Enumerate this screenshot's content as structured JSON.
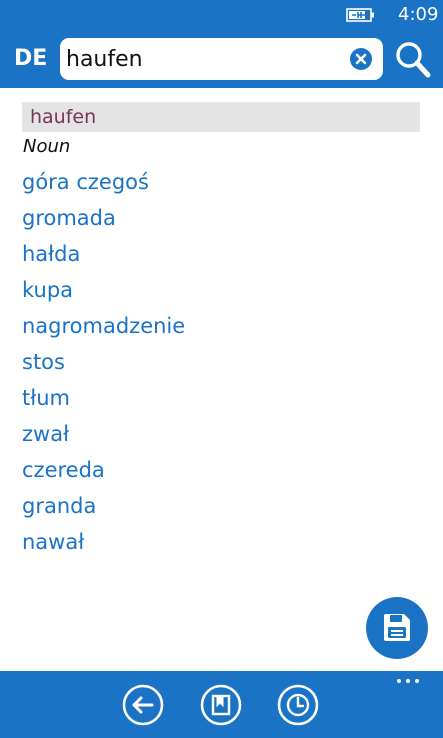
{
  "status_bar": {
    "time": "4:09",
    "battery_icon": "battery-charging-icon"
  },
  "header": {
    "language": "DE",
    "search": {
      "value": "haufen",
      "clear_icon": "clear-icon"
    },
    "search_icon": "search-icon"
  },
  "entry": {
    "headword": "haufen",
    "part_of_speech": "Noun",
    "translations": [
      "góra czegoś",
      "gromada",
      "hałda",
      "kupa",
      "nagromadzenie",
      "stos",
      "tłum",
      "zwał",
      "czereda",
      "granda",
      "nawał"
    ]
  },
  "save_button": {
    "icon": "save-icon"
  },
  "app_bar": {
    "buttons": [
      {
        "icon": "back-icon"
      },
      {
        "icon": "bookmark-icon"
      },
      {
        "icon": "history-icon"
      }
    ],
    "more_icon": "more-icon"
  },
  "colors": {
    "accent": "#1a73c5",
    "headword_bg": "#e4e4e4",
    "headword_text": "#7a3358",
    "background": "#ffffff"
  }
}
